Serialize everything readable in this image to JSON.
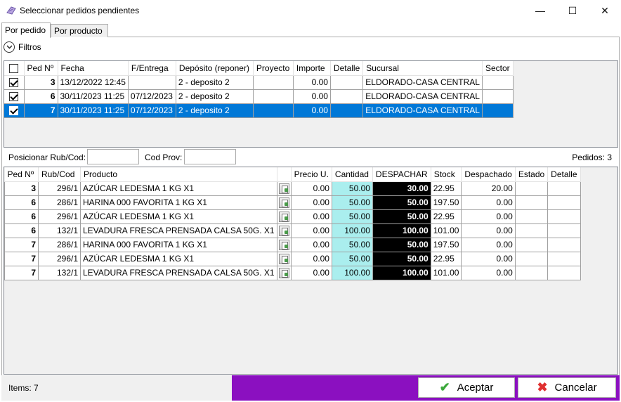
{
  "window": {
    "title": "Seleccionar pedidos pendientes",
    "minimize": "—",
    "maximize": "☐",
    "close": "✕"
  },
  "tabs": [
    {
      "label": "Por pedido",
      "active": true
    },
    {
      "label": "Por producto",
      "active": false
    }
  ],
  "filtros": {
    "label": "Filtros",
    "icon": "chevron-down-icon"
  },
  "orders": {
    "headers": [
      "",
      "Ped Nº",
      "Fecha",
      "F/Entrega",
      "Depósito (reponer)",
      "Proyecto",
      "Importe",
      "Detalle",
      "Sucursal",
      "Sector"
    ],
    "rows": [
      {
        "checked": true,
        "ped": "3",
        "fecha": "13/12/2022 12:45",
        "entrega": "",
        "deposito": "2 - deposito 2",
        "proyecto": "",
        "importe": "0.00",
        "detalle": "",
        "sucursal": "ELDORADO-CASA CENTRAL",
        "sector": "",
        "selected": false
      },
      {
        "checked": true,
        "ped": "6",
        "fecha": "30/11/2023 11:25",
        "entrega": "07/12/2023",
        "deposito": "2 - deposito 2",
        "proyecto": "",
        "importe": "0.00",
        "detalle": "",
        "sucursal": "ELDORADO-CASA CENTRAL",
        "sector": "",
        "selected": false
      },
      {
        "checked": true,
        "ped": "7",
        "fecha": "30/11/2023 11:25",
        "entrega": "07/12/2023",
        "deposito": "2 - deposito 2",
        "proyecto": "",
        "importe": "0.00",
        "detalle": "",
        "sucursal": "ELDORADO-CASA CENTRAL",
        "sector": "",
        "selected": true
      }
    ]
  },
  "positioning": {
    "rub_label": "Posicionar Rub/Cod:",
    "rub_value": "",
    "prov_label": "Cod Prov:",
    "prov_value": "",
    "pedidos": "Pedidos: 3"
  },
  "products": {
    "headers": [
      "Ped Nº",
      "Rub/Cod",
      "Producto",
      "",
      "Precio U.",
      "Cantidad",
      "DESPACHAR",
      "Stock",
      "Despachado",
      "Estado",
      "Detalle"
    ],
    "rows": [
      {
        "ped": "3",
        "rub": "296/1",
        "producto": "AZÚCAR LEDESMA 1 KG X1",
        "precio": "0.00",
        "cantidad": "50.00",
        "despachar": "30.00",
        "stock": "22.95",
        "despachado": "20.00",
        "estado": "",
        "detalle": ""
      },
      {
        "ped": "6",
        "rub": "286/1",
        "producto": "HARINA 000 FAVORITA 1 KG X1",
        "precio": "0.00",
        "cantidad": "50.00",
        "despachar": "50.00",
        "stock": "197.50",
        "despachado": "0.00",
        "estado": "",
        "detalle": ""
      },
      {
        "ped": "6",
        "rub": "296/1",
        "producto": "AZÚCAR LEDESMA 1 KG X1",
        "precio": "0.00",
        "cantidad": "50.00",
        "despachar": "50.00",
        "stock": "22.95",
        "despachado": "0.00",
        "estado": "",
        "detalle": ""
      },
      {
        "ped": "6",
        "rub": "132/1",
        "producto": "LEVADURA FRESCA PRENSADA CALSA 50G. X1",
        "precio": "0.00",
        "cantidad": "100.00",
        "despachar": "100.00",
        "stock": "101.00",
        "despachado": "0.00",
        "estado": "",
        "detalle": ""
      },
      {
        "ped": "7",
        "rub": "286/1",
        "producto": "HARINA 000 FAVORITA 1 KG X1",
        "precio": "0.00",
        "cantidad": "50.00",
        "despachar": "50.00",
        "stock": "197.50",
        "despachado": "0.00",
        "estado": "",
        "detalle": ""
      },
      {
        "ped": "7",
        "rub": "296/1",
        "producto": "AZÚCAR LEDESMA 1 KG X1",
        "precio": "0.00",
        "cantidad": "50.00",
        "despachar": "50.00",
        "stock": "22.95",
        "despachado": "0.00",
        "estado": "",
        "detalle": ""
      },
      {
        "ped": "7",
        "rub": "132/1",
        "producto": "LEVADURA FRESCA PRENSADA CALSA 50G. X1",
        "precio": "0.00",
        "cantidad": "100.00",
        "despachar": "100.00",
        "stock": "101.00",
        "despachado": "0.00",
        "estado": "",
        "detalle": ""
      }
    ]
  },
  "footer": {
    "items": "Items: 7",
    "accept_label": "Aceptar",
    "cancel_label": "Cancelar",
    "accept_icon": "check-icon",
    "cancel_icon": "x-icon"
  },
  "colors": {
    "selection": "#0078d7",
    "cantidad_bg": "#aaeeee",
    "despachar_bg": "#000000",
    "footer_accent": "#8b10c0"
  }
}
